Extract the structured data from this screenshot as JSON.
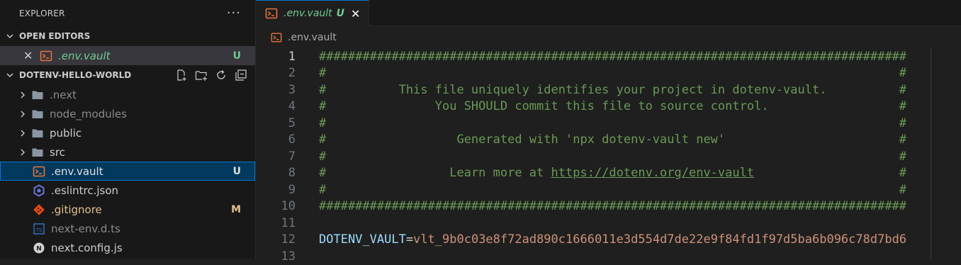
{
  "sidebar": {
    "title": "EXPLORER",
    "more": "···",
    "open_editors": {
      "header": "OPEN EDITORS",
      "items": [
        {
          "name": ".env.vault",
          "status": "U"
        }
      ]
    },
    "project": {
      "header": "DOTENV-HELLO-WORLD",
      "folders": [
        ".next",
        "node_modules",
        "public",
        "src"
      ],
      "files": [
        {
          "name": ".env.vault",
          "status": "U"
        },
        {
          "name": ".eslintrc.json",
          "status": ""
        },
        {
          "name": ".gitignore",
          "status": "M"
        },
        {
          "name": "next-env.d.ts",
          "status": ""
        },
        {
          "name": "next.config.js",
          "status": ""
        }
      ]
    }
  },
  "editor": {
    "tab": {
      "label": ".env.vault",
      "status": "U",
      "close": "✕"
    },
    "breadcrumb": ".env.vault",
    "lines": [
      {
        "n": "1",
        "text": "#################################################################################"
      },
      {
        "n": "2",
        "text": "#                                                                               #"
      },
      {
        "n": "3",
        "text": "#          This file uniquely identifies your project in dotenv-vault.          #"
      },
      {
        "n": "4",
        "text": "#               You SHOULD commit this file to source control.                  #"
      },
      {
        "n": "5",
        "text": "#                                                                               #"
      },
      {
        "n": "6",
        "text": "#                  Generated with 'npx dotenv-vault new'                        #"
      },
      {
        "n": "7",
        "text": "#                                                                               #"
      },
      {
        "n": "8",
        "pre": "#                 Learn more at ",
        "url": "https://dotenv.org/env-vault",
        "post": "                    #"
      },
      {
        "n": "9",
        "text": "#                                                                               #"
      },
      {
        "n": "10",
        "text": "#################################################################################"
      },
      {
        "n": "11",
        "text": ""
      },
      {
        "n": "12",
        "key": "DOTENV_VAULT",
        "eq": "=",
        "val": "vlt_9b0c03e8f72ad890c1666011e3d554d7de22e9f84fd1f97d5ba6b096c78d7bd6"
      },
      {
        "n": "13",
        "text": ""
      }
    ]
  },
  "colors": {
    "accent": "#0078d4",
    "untracked": "#73c991",
    "modified": "#e2c08d",
    "comment": "#6a9955"
  }
}
